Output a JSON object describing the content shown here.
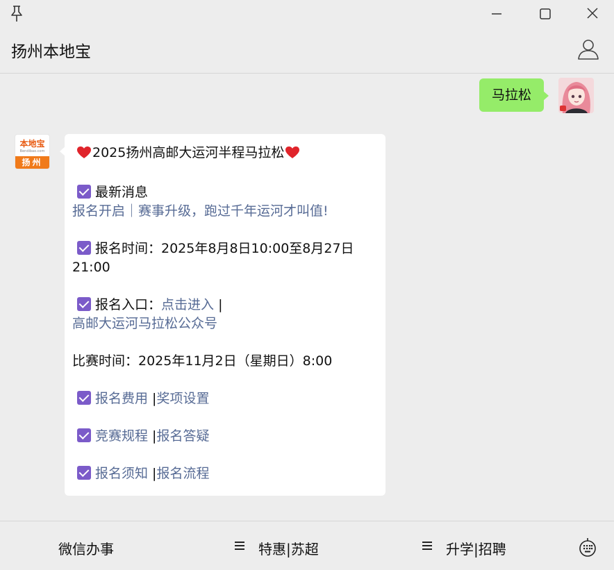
{
  "window": {
    "title": "扬州本地宝"
  },
  "messages": {
    "user_text": "马拉松",
    "bot_avatar": {
      "logo_top": "本地宝",
      "logo_mid": "Bendibao.com",
      "logo_bottom": "扬州"
    },
    "bot": {
      "title": "2025扬州高邮大运河半程马拉松",
      "news_label": "最新消息",
      "news_link": "报名开启｜赛事升级，跑过千年运河才叫值!",
      "reg_time_line1": "报名时间：2025年8月8日10:00至8月27日",
      "reg_time_line2": "21:00",
      "entry_label": "报名入口：",
      "entry_link": "点击进入",
      "separator": " |",
      "entry_link2": "高邮大运河马拉松公众号",
      "race_time": "比赛时间：2025年11月2日（星期日）8:00",
      "links": [
        {
          "a": "报名费用",
          "b": "奖项设置"
        },
        {
          "a": "竞赛规程",
          "b": "报名答疑"
        },
        {
          "a": "报名须知",
          "b": "报名流程"
        }
      ],
      "pipe": " |"
    }
  },
  "footer": {
    "menu1": "微信办事",
    "menu2": "特惠|苏超",
    "menu3": "升学|招聘"
  },
  "colors": {
    "user_bubble": "#95ec69",
    "link": "#576b95",
    "check": "#7b5bc9",
    "heart": "#e0242b",
    "brand_orange": "#f07a1a"
  }
}
